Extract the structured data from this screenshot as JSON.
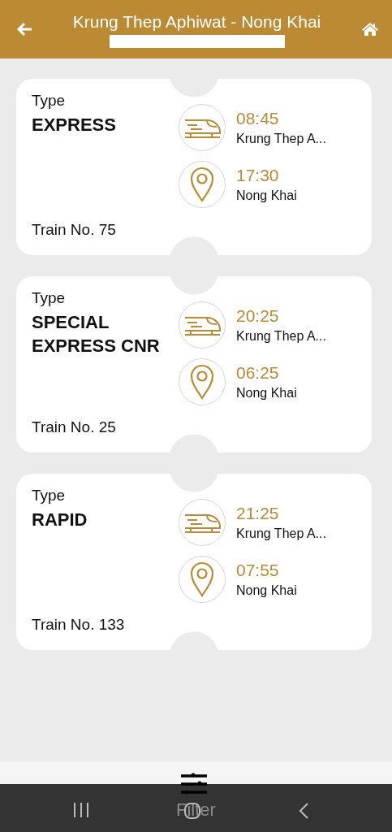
{
  "header": {
    "title": "Krung Thep Aphiwat - Nong Khai"
  },
  "trips": [
    {
      "type_label": "Type",
      "type": "EXPRESS",
      "train_no": "Train No. 75",
      "departure": {
        "time": "08:45",
        "station": "Krung Thep A..."
      },
      "arrival": {
        "time": "17:30",
        "station": "Nong Khai"
      }
    },
    {
      "type_label": "Type",
      "type": "SPECIAL EXPRESS CNR",
      "train_no": "Train No. 25",
      "departure": {
        "time": "20:25",
        "station": "Krung Thep A..."
      },
      "arrival": {
        "time": "06:25",
        "station": "Nong Khai"
      }
    },
    {
      "type_label": "Type",
      "type": "RAPID",
      "train_no": "Train No. 133",
      "departure": {
        "time": "21:25",
        "station": "Krung Thep A..."
      },
      "arrival": {
        "time": "07:55",
        "station": "Nong Khai"
      }
    }
  ],
  "filter": {
    "label": "Filter"
  }
}
